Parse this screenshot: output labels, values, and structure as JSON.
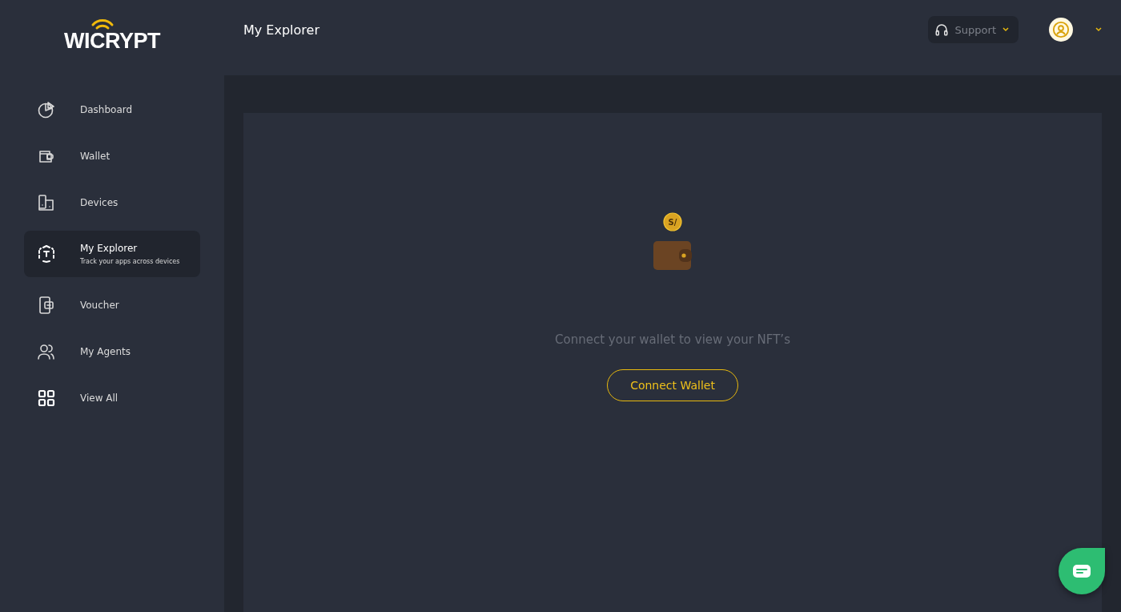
{
  "logo": {
    "text": "WICRYPT"
  },
  "header": {
    "title": "My Explorer",
    "support": {
      "label": "Support"
    }
  },
  "sidebar": {
    "items": [
      {
        "label": "Dashboard",
        "selected": false
      },
      {
        "label": "Wallet",
        "selected": false
      },
      {
        "label": "Devices",
        "selected": false
      },
      {
        "label": "My Explorer",
        "subtitle": "Track your apps across devices",
        "selected": true
      },
      {
        "label": "Voucher",
        "selected": false
      },
      {
        "label": "My Agents",
        "selected": false
      },
      {
        "label": "View All",
        "selected": false
      }
    ]
  },
  "empty_state": {
    "coin_label": "S/",
    "message": "Connect your wallet to view your NFT’s",
    "button": "Connect Wallet"
  }
}
